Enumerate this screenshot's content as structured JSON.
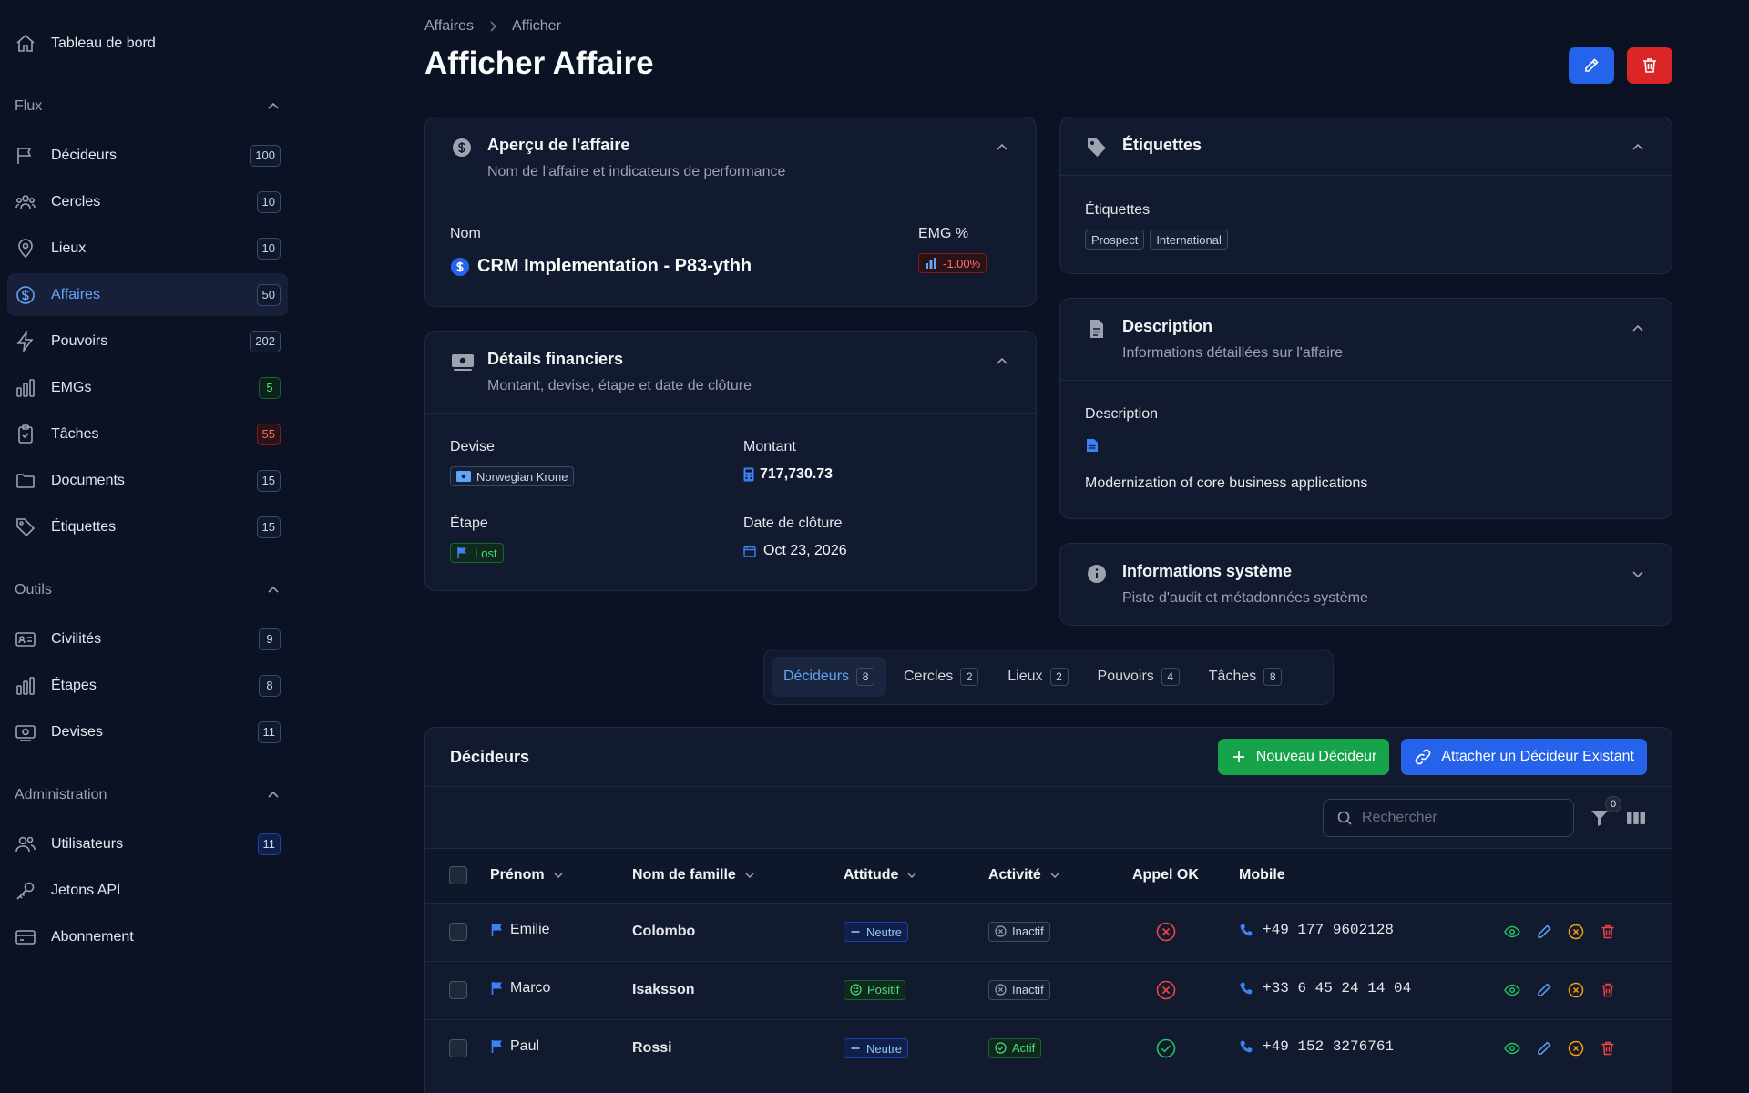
{
  "sidebar": {
    "top_item": {
      "label": "Tableau de bord"
    },
    "sections": [
      {
        "title": "Flux",
        "items": [
          {
            "label": "Décideurs",
            "count": "100"
          },
          {
            "label": "Cercles",
            "count": "10"
          },
          {
            "label": "Lieux",
            "count": "10"
          },
          {
            "label": "Affaires",
            "count": "50"
          },
          {
            "label": "Pouvoirs",
            "count": "202"
          },
          {
            "label": "EMGs",
            "count": "5"
          },
          {
            "label": "Tâches",
            "count": "55"
          },
          {
            "label": "Documents",
            "count": "15"
          },
          {
            "label": "Étiquettes",
            "count": "15"
          }
        ]
      },
      {
        "title": "Outils",
        "items": [
          {
            "label": "Civilités",
            "count": "9"
          },
          {
            "label": "Étapes",
            "count": "8"
          },
          {
            "label": "Devises",
            "count": "11"
          }
        ]
      },
      {
        "title": "Administration",
        "items": [
          {
            "label": "Utilisateurs",
            "count": "11"
          },
          {
            "label": "Jetons API"
          },
          {
            "label": "Abonnement"
          }
        ]
      }
    ]
  },
  "breadcrumb": [
    "Affaires",
    "Afficher"
  ],
  "page_title": "Afficher Affaire",
  "overview": {
    "title": "Aperçu de l'affaire",
    "subtitle": "Nom de l'affaire et indicateurs de performance",
    "name_label": "Nom",
    "name_value": "CRM Implementation - P83-ythh",
    "emg_label": "EMG %",
    "emg_value": "-1.00%"
  },
  "financial": {
    "title": "Détails financiers",
    "subtitle": "Montant, devise, étape et date de clôture",
    "currency_label": "Devise",
    "currency_value": "Norwegian Krone",
    "amount_label": "Montant",
    "amount_value": "717,730.73",
    "stage_label": "Étape",
    "stage_value": "Lost",
    "close_label": "Date de clôture",
    "close_value": "Oct 23, 2026"
  },
  "tags": {
    "title": "Étiquettes",
    "field_label": "Étiquettes",
    "items": [
      "Prospect",
      "International"
    ]
  },
  "description": {
    "title": "Description",
    "subtitle": "Informations détaillées sur l'affaire",
    "field_label": "Description",
    "value": "Modernization of core business applications"
  },
  "system": {
    "title": "Informations système",
    "subtitle": "Piste d'audit et métadonnées système"
  },
  "tabs": [
    {
      "label": "Décideurs",
      "count": "8"
    },
    {
      "label": "Cercles",
      "count": "2"
    },
    {
      "label": "Lieux",
      "count": "2"
    },
    {
      "label": "Pouvoirs",
      "count": "4"
    },
    {
      "label": "Tâches",
      "count": "8"
    }
  ],
  "table": {
    "title": "Décideurs",
    "new_button": "Nouveau Décideur",
    "attach_button": "Attacher un Décideur Existant",
    "search_placeholder": "Rechercher",
    "filter_count": "0",
    "columns": [
      "Prénom",
      "Nom de famille",
      "Attitude",
      "Activité",
      "Appel OK",
      "Mobile"
    ],
    "rows": [
      {
        "first": "Emilie",
        "last": "Colombo",
        "attitude": "Neutre",
        "activity": "Inactif",
        "call_ok": false,
        "mobile": "+49 177 9602128"
      },
      {
        "first": "Marco",
        "last": "Isaksson",
        "attitude": "Positif",
        "activity": "Inactif",
        "call_ok": false,
        "mobile": "+33 6 45 24 14 04"
      },
      {
        "first": "Paul",
        "last": "Rossi",
        "attitude": "Neutre",
        "activity": "Actif",
        "call_ok": true,
        "mobile": "+49 152 3276761"
      }
    ]
  },
  "colors": {
    "background": "#0b1224",
    "card": "#111a2e",
    "accent_blue": "#2563eb",
    "danger_red": "#dc2626",
    "success_green": "#16a34a"
  }
}
